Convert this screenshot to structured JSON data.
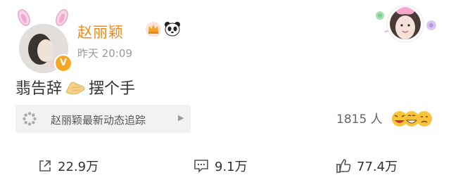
{
  "post": {
    "author_name": "赵丽颖",
    "timestamp": "昨天 20:09",
    "text_before": "翡告辞",
    "text_after": "摆个手",
    "topic": {
      "label": "赵丽颖最新动态追踪"
    },
    "reaction_count": "1815 人",
    "actions": {
      "repost": "22.9万",
      "comment": "9.1万",
      "like": "77.4万"
    }
  },
  "colors": {
    "author_name": "#f08a1c",
    "verified_badge": "#f5a623",
    "topic_bg": "#f2f2f2"
  }
}
